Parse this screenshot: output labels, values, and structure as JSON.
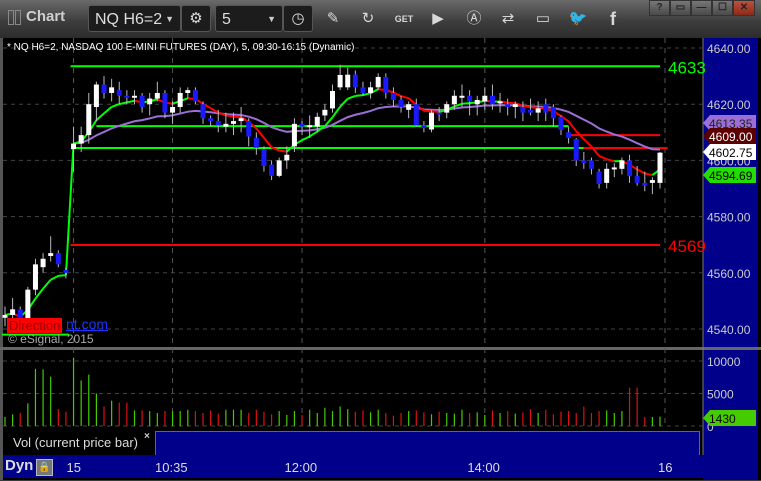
{
  "window": {
    "title": "Chart"
  },
  "toolbar": {
    "symbol": "NQ H6=2",
    "interval": "5",
    "icons": [
      "settings-icon",
      "clock-icon",
      "pencil-icon",
      "refresh-icon",
      "get-icon",
      "play-icon",
      "alert-icon",
      "link-icon",
      "comment-icon",
      "twitter-icon",
      "facebook-icon"
    ],
    "window_buttons": [
      "?",
      "▭",
      "—",
      "☐",
      "✕"
    ]
  },
  "chart": {
    "header": "* NQ H6=2, NASDAQ 100 E-MINI FUTURES (DAY), 5, 09:30-16:15 (Dynamic)",
    "watermark": {
      "left": "Direction",
      "right": "nt.com",
      "copyright": "© eSignal, 2015"
    },
    "colors": {
      "up": "#ffffff",
      "down": "#1a1aff",
      "bg": "#000000",
      "axis": "#00008a",
      "green": "#00ff00",
      "red": "#ff0000",
      "purple": "#9b6fd6"
    }
  },
  "chart_data": {
    "type": "candlestick",
    "ylim": [
      4530,
      4645
    ],
    "y_ticks": [
      "4540.00",
      "4560.00",
      "4580.00",
      "4600.00",
      "4620.00",
      "4640.00"
    ],
    "y_tick_values": [
      4540,
      4560,
      4580,
      4600,
      4620,
      4640
    ],
    "x_ticks": [
      {
        "label": "15",
        "bar": 9
      },
      {
        "label": "10:35",
        "bar": 22
      },
      {
        "label": "12:00",
        "bar": 39
      },
      {
        "label": "14:00",
        "bar": 63
      },
      {
        "label": "16",
        "bar": 87
      }
    ],
    "session_start_bar": 9,
    "candles": [
      [
        4544,
        4548,
        4541,
        4545
      ],
      [
        4545,
        4551,
        4543,
        4547
      ],
      [
        4547,
        4548,
        4540,
        4541
      ],
      [
        4541,
        4555,
        4540,
        4554
      ],
      [
        4554,
        4565,
        4552,
        4563
      ],
      [
        4562,
        4567,
        4560,
        4565
      ],
      [
        4566,
        4573,
        4564,
        4567
      ],
      [
        4567,
        4568,
        4562,
        4563
      ],
      [
        4561,
        4562,
        4558,
        4560
      ],
      [
        4604,
        4612,
        4596,
        4606
      ],
      [
        4606,
        4612,
        4603,
        4609
      ],
      [
        4609,
        4624,
        4606,
        4620
      ],
      [
        4619,
        4628,
        4614,
        4627
      ],
      [
        4627,
        4630,
        4622,
        4624
      ],
      [
        4624,
        4629,
        4621,
        4626
      ],
      [
        4625,
        4628,
        4620,
        4623
      ],
      [
        4623,
        4625,
        4620,
        4622.5
      ],
      [
        4622.5,
        4625,
        4620,
        4623
      ],
      [
        4623,
        4624,
        4617,
        4619
      ],
      [
        4620,
        4624,
        4616,
        4622
      ],
      [
        4622,
        4628,
        4621,
        4624
      ],
      [
        4624,
        4625,
        4615,
        4617
      ],
      [
        4617,
        4621,
        4613,
        4619
      ],
      [
        4619,
        4626,
        4617,
        4624
      ],
      [
        4624,
        4626,
        4622,
        4625
      ],
      [
        4625,
        4626,
        4620,
        4621
      ],
      [
        4620,
        4621,
        4613,
        4615
      ],
      [
        4615,
        4616,
        4612,
        4614
      ],
      [
        4614,
        4618,
        4610,
        4612.5
      ],
      [
        4612,
        4617,
        4610,
        4613
      ],
      [
        4613,
        4617,
        4609,
        4614
      ],
      [
        4614,
        4619,
        4610,
        4615
      ],
      [
        4614,
        4615,
        4605,
        4608.5
      ],
      [
        4608,
        4610,
        4602,
        4604.5
      ],
      [
        4604,
        4605,
        4596,
        4598
      ],
      [
        4598.5,
        4600,
        4593,
        4594.5
      ],
      [
        4594.5,
        4601,
        4594,
        4600
      ],
      [
        4600,
        4605,
        4597,
        4602
      ],
      [
        4605,
        4615,
        4603,
        4613
      ],
      [
        4613,
        4614,
        4609,
        4612
      ],
      [
        4612,
        4616,
        4608,
        4612.5
      ],
      [
        4612,
        4617,
        4610,
        4615.5
      ],
      [
        4616,
        4620,
        4614,
        4618
      ],
      [
        4618.5,
        4627,
        4617,
        4624.7
      ],
      [
        4626,
        4634,
        4625,
        4630.4
      ],
      [
        4626,
        4633,
        4625,
        4630.5
      ],
      [
        4630.6,
        4632,
        4624,
        4626
      ],
      [
        4626,
        4628,
        4623,
        4624
      ],
      [
        4624,
        4628,
        4622,
        4626
      ],
      [
        4626,
        4631,
        4625,
        4629.7
      ],
      [
        4629.7,
        4631,
        4622,
        4624
      ],
      [
        4624,
        4626,
        4619,
        4621.5
      ],
      [
        4621.5,
        4623,
        4617,
        4619
      ],
      [
        4618,
        4621,
        4615,
        4620
      ],
      [
        4620,
        4622,
        4612,
        4612.5
      ],
      [
        4612.5,
        4614,
        4610,
        4611.5
      ],
      [
        4611,
        4618,
        4610,
        4617
      ],
      [
        4617,
        4619,
        4614,
        4616.5
      ],
      [
        4617,
        4621,
        4615,
        4620
      ],
      [
        4620,
        4625,
        4618,
        4623
      ],
      [
        4622.5,
        4627,
        4619,
        4623
      ],
      [
        4623,
        4625,
        4616,
        4621
      ],
      [
        4620,
        4623,
        4616,
        4621.5
      ],
      [
        4621,
        4626,
        4618,
        4623
      ],
      [
        4623,
        4627,
        4618,
        4620
      ],
      [
        4620.5,
        4624,
        4617,
        4621
      ],
      [
        4620,
        4622,
        4616,
        4619
      ],
      [
        4619,
        4621,
        4615,
        4620
      ],
      [
        4619,
        4621,
        4614,
        4617
      ],
      [
        4618,
        4622,
        4616,
        4617
      ],
      [
        4617,
        4621,
        4614,
        4618.5
      ],
      [
        4620,
        4622,
        4614,
        4617
      ],
      [
        4619,
        4620,
        4612,
        4615
      ],
      [
        4615.5,
        4616,
        4609,
        4610.8
      ],
      [
        4610,
        4612,
        4606,
        4608
      ],
      [
        4607.6,
        4608,
        4598,
        4600
      ],
      [
        4600,
        4603,
        4597,
        4599
      ],
      [
        4600,
        4601,
        4595,
        4597
      ],
      [
        4596,
        4597,
        4590,
        4591.6
      ],
      [
        4592,
        4599,
        4590,
        4597
      ],
      [
        4597,
        4599,
        4594,
        4597.5
      ],
      [
        4597,
        4601,
        4595,
        4600
      ],
      [
        4600,
        4602,
        4592,
        4594.4
      ],
      [
        4594.4,
        4598,
        4591,
        4592
      ],
      [
        4592,
        4596,
        4589,
        4591
      ],
      [
        4592,
        4594,
        4588,
        4593
      ],
      [
        4592,
        4603,
        4590,
        4602.75
      ]
    ],
    "levels": [
      {
        "price": 4633.5,
        "color": "#00ff00",
        "from_bar": 9,
        "to_bar": 86,
        "label": "4633"
      },
      {
        "price": 4569.9,
        "color": "#ff0000",
        "from_bar": 9,
        "to_bar": 86,
        "label": "4569"
      },
      {
        "price": 4538.0,
        "color": "#00ff00",
        "from_bar": 0,
        "to_bar": 8,
        "label": ""
      }
    ],
    "step_lines": [
      {
        "price": 4604.4,
        "from_bar": 9,
        "to_bar": 76,
        "color": "#00ff00"
      },
      {
        "price": 4604.4,
        "from_bar": 76,
        "to_bar": 87,
        "color": "#ff0000"
      },
      {
        "price": 4612.2,
        "from_bar": 12,
        "to_bar": 74,
        "color": "#00ff00"
      },
      {
        "price": 4609.0,
        "from_bar": 74,
        "to_bar": 86,
        "color": "#ff0000"
      }
    ],
    "price_tags": [
      {
        "value": "4613.35",
        "bg": "#9b6fd6",
        "fg": "#222222",
        "price": 4613.35
      },
      {
        "value": "4609.00",
        "bg": "#5a0000",
        "fg": "#ffffff",
        "price": 4609.0
      },
      {
        "value": "4602.75",
        "bg": "#ffffff",
        "fg": "#000000",
        "price": 4602.75
      },
      {
        "value": "4594.69",
        "bg": "#22dd00",
        "fg": "#000000",
        "price": 4594.69
      }
    ],
    "volume": {
      "label": "Vol (current price bar)",
      "ylim": [
        0,
        11500
      ],
      "y_ticks": [
        "0",
        "5000",
        "10000"
      ],
      "y_tick_values": [
        0,
        5000,
        10000
      ],
      "current": "1430",
      "values": [
        1400,
        1800,
        2000,
        3500,
        8800,
        8700,
        7600,
        2600,
        2200,
        10500,
        7000,
        7900,
        5000,
        3000,
        3900,
        3600,
        3600,
        2400,
        2400,
        2300,
        2000,
        2300,
        2300,
        2300,
        2500,
        2300,
        2000,
        2400,
        1900,
        2500,
        2500,
        2500,
        2000,
        2500,
        2200,
        1800,
        2300,
        1700,
        2300,
        1700,
        2500,
        2000,
        2800,
        2300,
        3000,
        2600,
        2200,
        2400,
        2100,
        2500,
        2000,
        1600,
        2000,
        2300,
        2400,
        2100,
        1800,
        2200,
        2000,
        1900,
        2500,
        2000,
        2100,
        1700,
        2400,
        2000,
        2300,
        1900,
        2100,
        2600,
        2000,
        2500,
        1800,
        2200,
        2300,
        2000,
        3000,
        2000,
        2300,
        2400,
        2000,
        2300,
        5900,
        5900,
        1400,
        1400,
        1430
      ]
    }
  },
  "footer": {
    "dyn": "Dyn"
  }
}
